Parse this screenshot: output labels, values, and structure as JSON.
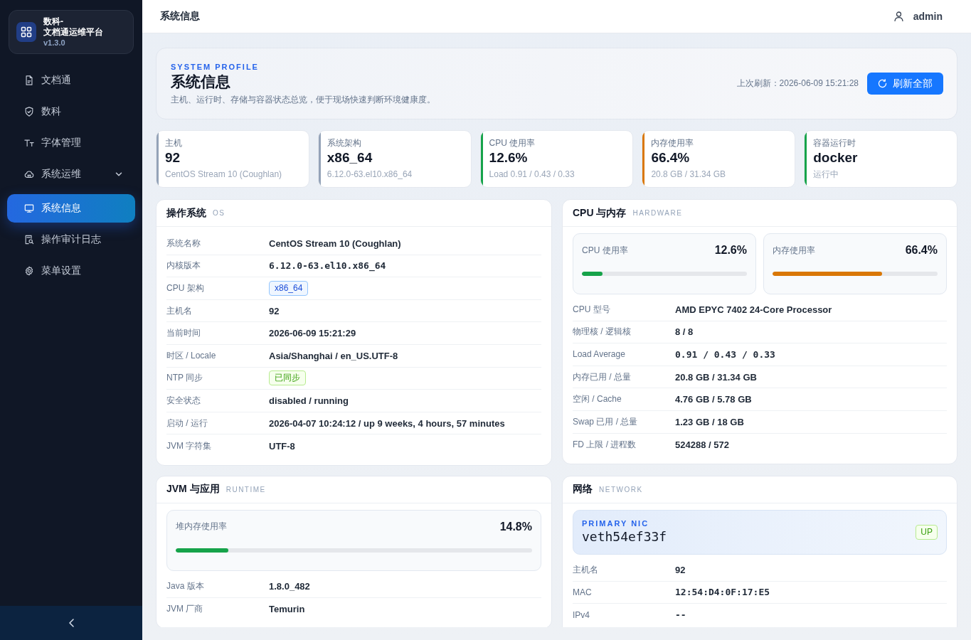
{
  "sidebar": {
    "brand": {
      "title_line_1": "数科-",
      "title_line_2": "文档通运维平台",
      "version": "v1.3.0"
    },
    "nav": [
      {
        "label": "文档通",
        "selected": false
      },
      {
        "label": "数科",
        "selected": false
      },
      {
        "label": "字体管理",
        "selected": false
      },
      {
        "label": "系统运维",
        "selected": false,
        "expanded": true,
        "children": [
          {
            "label": "系统信息",
            "selected": true
          },
          {
            "label": "操作审计日志",
            "selected": false
          },
          {
            "label": "菜单设置",
            "selected": false
          }
        ]
      }
    ]
  },
  "header": {
    "title": "系统信息",
    "user": "admin"
  },
  "hero": {
    "eyebrow": "SYSTEM PROFILE",
    "title": "系统信息",
    "subtitle": "主机、运行时、存储与容器状态总览，便于现场快速判断环境健康度。",
    "last_refresh": "上次刷新：2026-06-09 15:21:28",
    "refresh_button": "刷新全部"
  },
  "stats": [
    {
      "label": "主机",
      "value": "92",
      "detail": "CentOS Stream 10 (Coughlan)",
      "color": "#94a3b8"
    },
    {
      "label": "系统架构",
      "value": "x86_64",
      "detail": "6.12.0-63.el10.x86_64",
      "color": "#94a3b8"
    },
    {
      "label": "CPU 使用率",
      "value": "12.6%",
      "detail": "Load 0.91 / 0.43 / 0.33",
      "color": "#16a34a"
    },
    {
      "label": "内存使用率",
      "value": "66.4%",
      "detail": "20.8 GB / 31.34 GB",
      "color": "#d97706"
    },
    {
      "label": "容器运行时",
      "value": "docker",
      "detail": "运行中",
      "color": "#16a34a"
    }
  ],
  "panels": [
    {
      "title": "操作系统",
      "tag": "OS",
      "rows": [
        {
          "label": "系统名称",
          "value": "CentOS Stream 10 (Coughlan)",
          "kind": "text"
        },
        {
          "label": "内核版本",
          "value": "6.12.0-63.el10.x86_64",
          "kind": "mono"
        },
        {
          "label": "CPU 架构",
          "value": "x86_64",
          "kind": "tag"
        },
        {
          "label": "主机名",
          "value": "92",
          "kind": "text"
        },
        {
          "label": "当前时间",
          "value": "2026-06-09 15:21:29",
          "kind": "text"
        },
        {
          "label": "时区 / Locale",
          "value": "Asia/Shanghai / en_US.UTF-8",
          "kind": "text"
        },
        {
          "label": "NTP 同步",
          "value": "已同步",
          "kind": "badge"
        },
        {
          "label": "安全状态",
          "value": "disabled / running",
          "kind": "text"
        },
        {
          "label": "启动 / 运行",
          "value": "2026-04-07 10:24:12 / up 9 weeks, 4 hours, 57 minutes",
          "kind": "text"
        },
        {
          "label": "JVM 字符集",
          "value": "UTF-8",
          "kind": "text"
        }
      ]
    },
    {
      "title": "CPU 与内存",
      "tag": "HARDWARE",
      "meters": [
        {
          "label": "CPU 使用率",
          "reading": "12.6%",
          "level": 0.126
        },
        {
          "label": "内存使用率",
          "reading": "66.4%",
          "level": 0.664
        }
      ],
      "rows": [
        {
          "label": "CPU 型号",
          "value": "AMD EPYC 7402 24-Core Processor",
          "kind": "text"
        },
        {
          "label": "物理核 / 逻辑核",
          "value": "8 / 8",
          "kind": "text"
        },
        {
          "label": "Load Average",
          "value": "0.91 / 0.43 / 0.33",
          "kind": "mono"
        },
        {
          "label": "内存已用 / 总量",
          "value": "20.8 GB / 31.34 GB",
          "kind": "text"
        },
        {
          "label": "空闲 / Cache",
          "value": "4.76 GB / 5.78 GB",
          "kind": "text"
        },
        {
          "label": "Swap 已用 / 总量",
          "value": "1.23 GB / 18 GB",
          "kind": "text"
        },
        {
          "label": "FD 上限 / 进程数",
          "value": "524288 / 572",
          "kind": "text"
        }
      ]
    },
    {
      "title": "JVM 与应用",
      "tag": "RUNTIME",
      "meters": [
        {
          "label": "堆内存使用率",
          "reading": "14.8%",
          "level": 0.148
        }
      ],
      "rows": [
        {
          "label": "Java 版本",
          "value": "1.8.0_482",
          "kind": "text"
        },
        {
          "label": "JVM 厂商",
          "value": "Temurin",
          "kind": "text"
        }
      ]
    },
    {
      "title": "网络",
      "tag": "NETWORK",
      "nic": {
        "eyebrow": "PRIMARY NIC",
        "name": "veth54ef33f",
        "status": "UP"
      },
      "rows": [
        {
          "label": "主机名",
          "value": "92",
          "kind": "text"
        },
        {
          "label": "MAC",
          "value": "12:54:D4:0F:17:E5",
          "kind": "mono"
        },
        {
          "label": "IPv4",
          "value": "--",
          "kind": "mono"
        }
      ]
    }
  ]
}
